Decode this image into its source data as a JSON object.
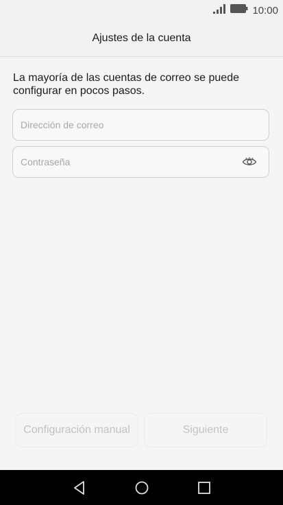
{
  "status_bar": {
    "time": "10:00",
    "icons": [
      "signal-icon",
      "battery-icon"
    ]
  },
  "header": {
    "title": "Ajustes de la cuenta"
  },
  "form": {
    "intro": "La mayoría de las cuentas de correo se puede configurar en pocos pasos.",
    "email_placeholder": "Dirección de correo",
    "email_value": "",
    "password_placeholder": "Contraseña",
    "password_value": "",
    "password_toggle_icon": "eye-icon"
  },
  "buttons": {
    "manual_label": "Configuración manual",
    "next_label": "Siguiente"
  },
  "nav": {
    "icons": [
      "back-icon",
      "home-icon",
      "recent-apps-icon"
    ]
  },
  "colors": {
    "background": "#f5f5f5",
    "disabled_text": "#c2c2c2",
    "field_border": "#cfcfcf",
    "nav_bar": "#000000"
  }
}
